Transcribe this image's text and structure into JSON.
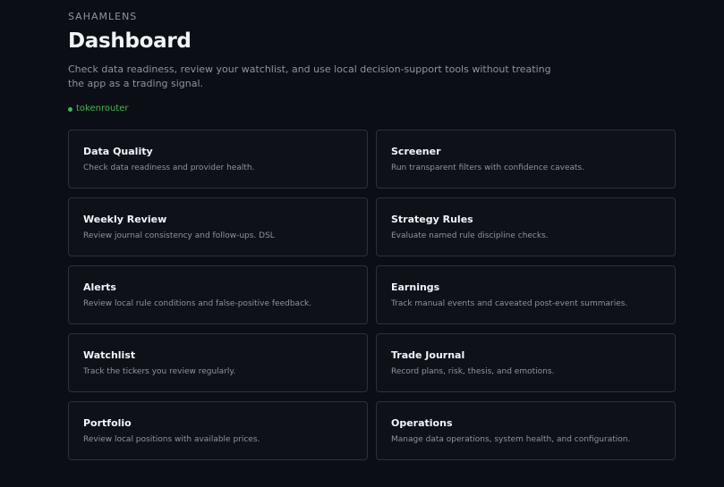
{
  "header": {
    "eyebrow": "SAHAMLENS",
    "title": "Dashboard",
    "subtitle": "Check data readiness, review your watchlist, and use local decision-support tools without treating the app as a trading signal.",
    "status_label": "tokenrouter",
    "status_color": "#3fb950"
  },
  "cards": [
    {
      "title": "Data Quality",
      "description": "Check data readiness and provider health."
    },
    {
      "title": "Screener",
      "description": "Run transparent filters with confidence caveats."
    },
    {
      "title": "Weekly Review",
      "description": "Review journal consistency and follow-ups. DSL"
    },
    {
      "title": "Strategy Rules",
      "description": "Evaluate named rule discipline checks."
    },
    {
      "title": "Alerts",
      "description": "Review local rule conditions and false-positive feedback."
    },
    {
      "title": "Earnings",
      "description": "Track manual events and caveated post-event summaries."
    },
    {
      "title": "Watchlist",
      "description": "Track the tickers you review regularly."
    },
    {
      "title": "Trade Journal",
      "description": "Record plans, risk, thesis, and emotions."
    },
    {
      "title": "Portfolio",
      "description": "Review local positions with available prices."
    },
    {
      "title": "Operations",
      "description": "Manage data operations, system health, and configuration."
    }
  ]
}
